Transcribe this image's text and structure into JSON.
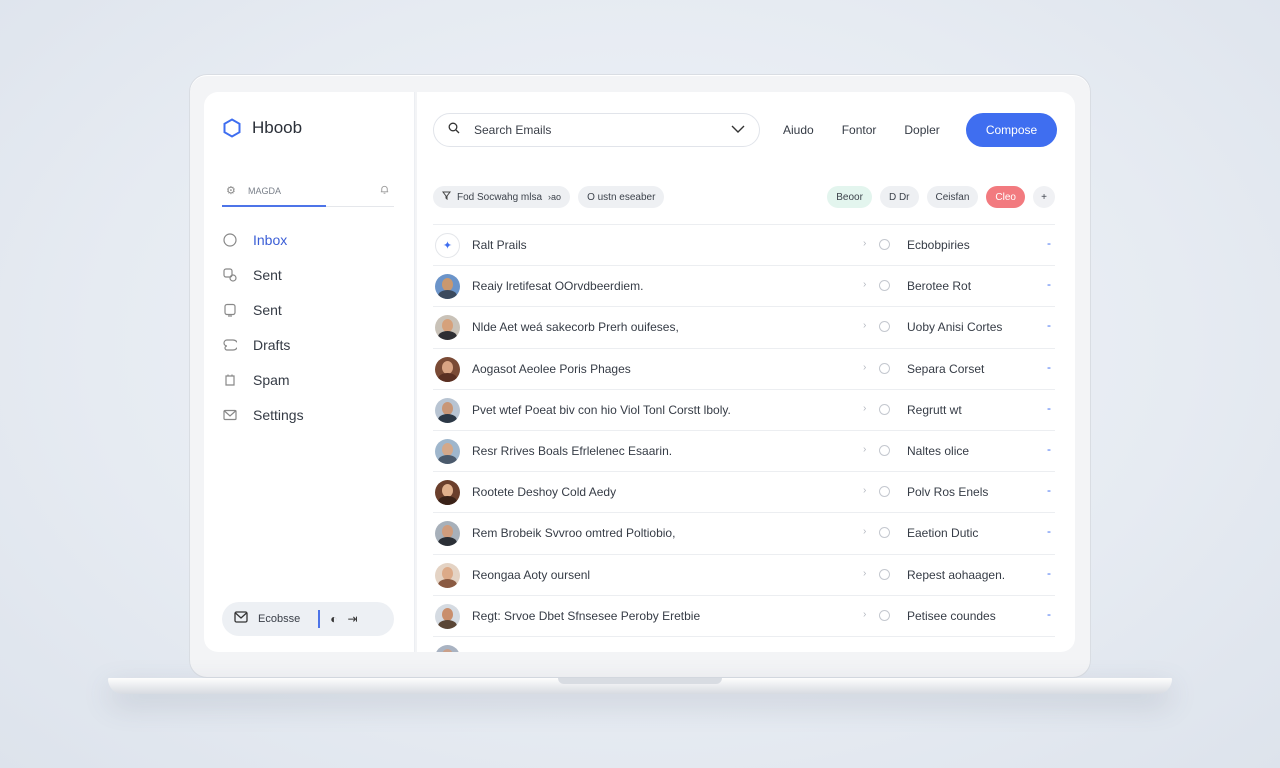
{
  "app": {
    "name": "Hboob"
  },
  "sidebar": {
    "tab_label": "MAGDA",
    "items": [
      {
        "label": "Inbox",
        "icon": "circle-icon",
        "active": true
      },
      {
        "label": "Sent",
        "icon": "users-icon",
        "active": false
      },
      {
        "label": "Sent",
        "icon": "square-icon",
        "active": false
      },
      {
        "label": "Drafts",
        "icon": "draft-icon",
        "active": false
      },
      {
        "label": "Spam",
        "icon": "spam-icon",
        "active": false
      },
      {
        "label": "Settings",
        "icon": "envelope-icon",
        "active": false
      }
    ],
    "bottom_label": "Ecobsse"
  },
  "header": {
    "search_placeholder": "Search Emails",
    "links": [
      "Aiudo",
      "Fontor",
      "Dopler"
    ],
    "compose_label": "Compose"
  },
  "filters": {
    "left": [
      "Fod Socwahg mlsa",
      "O ustn eseaber"
    ],
    "left_arrow": "›ao",
    "right": [
      "Beoor",
      "D Dr",
      "Ceisfan",
      "Cleo"
    ],
    "plus": "+"
  },
  "colors": {
    "accent": "#3f6ef0",
    "active_nav": "#3b5ed6",
    "status_red": "#f27a7f",
    "status_green": "#e3f5ee"
  },
  "emails": [
    {
      "subject": "Ralt Prails",
      "sender": "Ecbobpiries",
      "pinned": true
    },
    {
      "subject": "Reaiy lretifesat OOrvdbeerdiem.",
      "sender": "Berotee Rot",
      "pinned": false
    },
    {
      "subject": "Nlde Aet weá sakecorb Prerh ouifeses,",
      "sender": "Uoby Anisi Cortes",
      "pinned": false
    },
    {
      "subject": "Aogasot Aeolee Poris Phages",
      "sender": "Separa Corset",
      "pinned": false
    },
    {
      "subject": "Pvet wtef Poeat biv con hio Viol Tonl Corstt lboly.",
      "sender": "Regrutt wt",
      "pinned": false
    },
    {
      "subject": "Resr Rrives Boals Efrlelenec Esaarin.",
      "sender": "Naltes olice",
      "pinned": false
    },
    {
      "subject": "Rootete Deshoy Cold Aedy",
      "sender": "Polv Ros Enels",
      "pinned": false
    },
    {
      "subject": "Rem Brobeik Svvroo omtred Poltiobio,",
      "sender": "Eaetion Dutic",
      "pinned": false
    },
    {
      "subject": "Reongaa Aoty oursenl",
      "sender": "Repest aohaagen.",
      "pinned": false
    },
    {
      "subject": "Regt: Srvoe Dbet Sfnsesee Peroby Eretbie",
      "sender": "Petisee coundes",
      "pinned": false
    }
  ]
}
